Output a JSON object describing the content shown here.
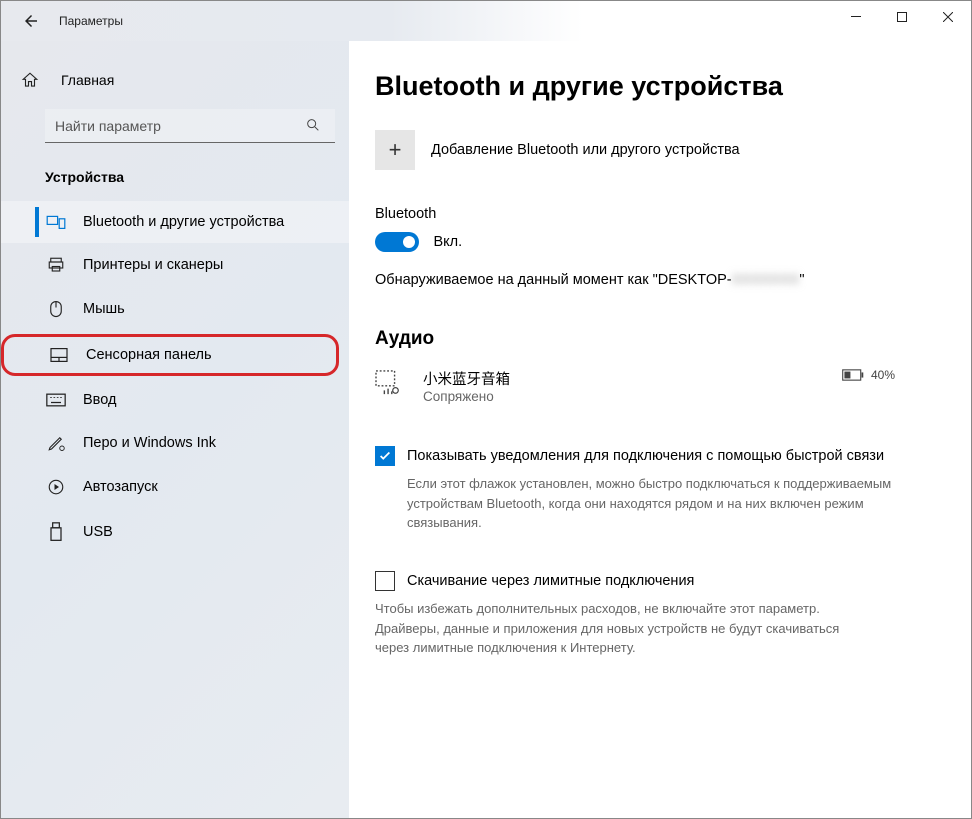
{
  "app_title": "Параметры",
  "window": {
    "minimize": "−",
    "maximize": "□",
    "close": "✕"
  },
  "home_label": "Главная",
  "search_placeholder": "Найти параметр",
  "sidebar_section": "Устройства",
  "sidebar": {
    "items": [
      {
        "label": "Bluetooth и другие устройства"
      },
      {
        "label": "Принтеры и сканеры"
      },
      {
        "label": "Мышь"
      },
      {
        "label": "Сенсорная панель"
      },
      {
        "label": "Ввод"
      },
      {
        "label": "Перо и Windows Ink"
      },
      {
        "label": "Автозапуск"
      },
      {
        "label": "USB"
      }
    ]
  },
  "page_title": "Bluetooth и другие устройства",
  "add_device": "Добавление Bluetooth или другого устройства",
  "plus": "+",
  "bt_label": "Bluetooth",
  "toggle_on": "Вкл.",
  "discover_prefix": "Обнаруживаемое на данный момент как \"DESKTOP-",
  "discover_blur": "XXXXXXX",
  "discover_suffix": "\"",
  "audio_heading": "Аудио",
  "device1_name": "小米蓝牙音箱",
  "device1_status": "Сопряжено",
  "battery": "40%",
  "cb1_label": "Показывать уведомления для подключения с помощью быстрой связи",
  "cb1_help": "Если этот флажок установлен, можно быстро подключаться к поддерживаемым устройствам Bluetooth, когда они находятся рядом и на них включен режим связывания.",
  "cb2_label": "Скачивание через лимитные подключения",
  "cb2_help": "Чтобы избежать дополнительных расходов, не включайте этот параметр. Драйверы, данные и приложения для новых устройств не будут скачиваться через лимитные подключения к Интернету."
}
